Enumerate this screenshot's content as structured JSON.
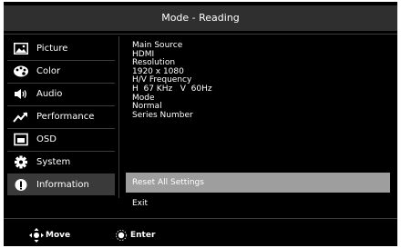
{
  "header": {
    "title": "Mode - Reading"
  },
  "sidebar": {
    "items": [
      {
        "label": "Picture",
        "icon": "picture-icon"
      },
      {
        "label": "Color",
        "icon": "palette-icon"
      },
      {
        "label": "Audio",
        "icon": "speaker-icon"
      },
      {
        "label": "Performance",
        "icon": "trend-arrow-icon"
      },
      {
        "label": "OSD",
        "icon": "osd-window-icon"
      },
      {
        "label": "System",
        "icon": "gear-icon"
      },
      {
        "label": "Information",
        "icon": "info-icon"
      }
    ],
    "active": "Information"
  },
  "info": {
    "lines": [
      "Main Source",
      "HDMI",
      "Resolution",
      "1920 x 1080",
      "H/V Frequency",
      "H  67 KHz   V  60Hz",
      "Mode",
      "Normal",
      "Series Number"
    ]
  },
  "options": [
    {
      "label": "Reset All Settings",
      "selected": true
    },
    {
      "label": "Exit",
      "selected": false
    }
  ],
  "footer": {
    "move_label": "Move",
    "enter_label": "Enter",
    "move_icon": "joystick-move-icon",
    "enter_icon": "joystick-enter-icon"
  },
  "colors": {
    "background": "#000000",
    "header_bg": "#2f2f2f",
    "active_item_bg": "#3a3a3a",
    "selected_option_bg": "#9e9e9e",
    "text": "#ffffff"
  }
}
